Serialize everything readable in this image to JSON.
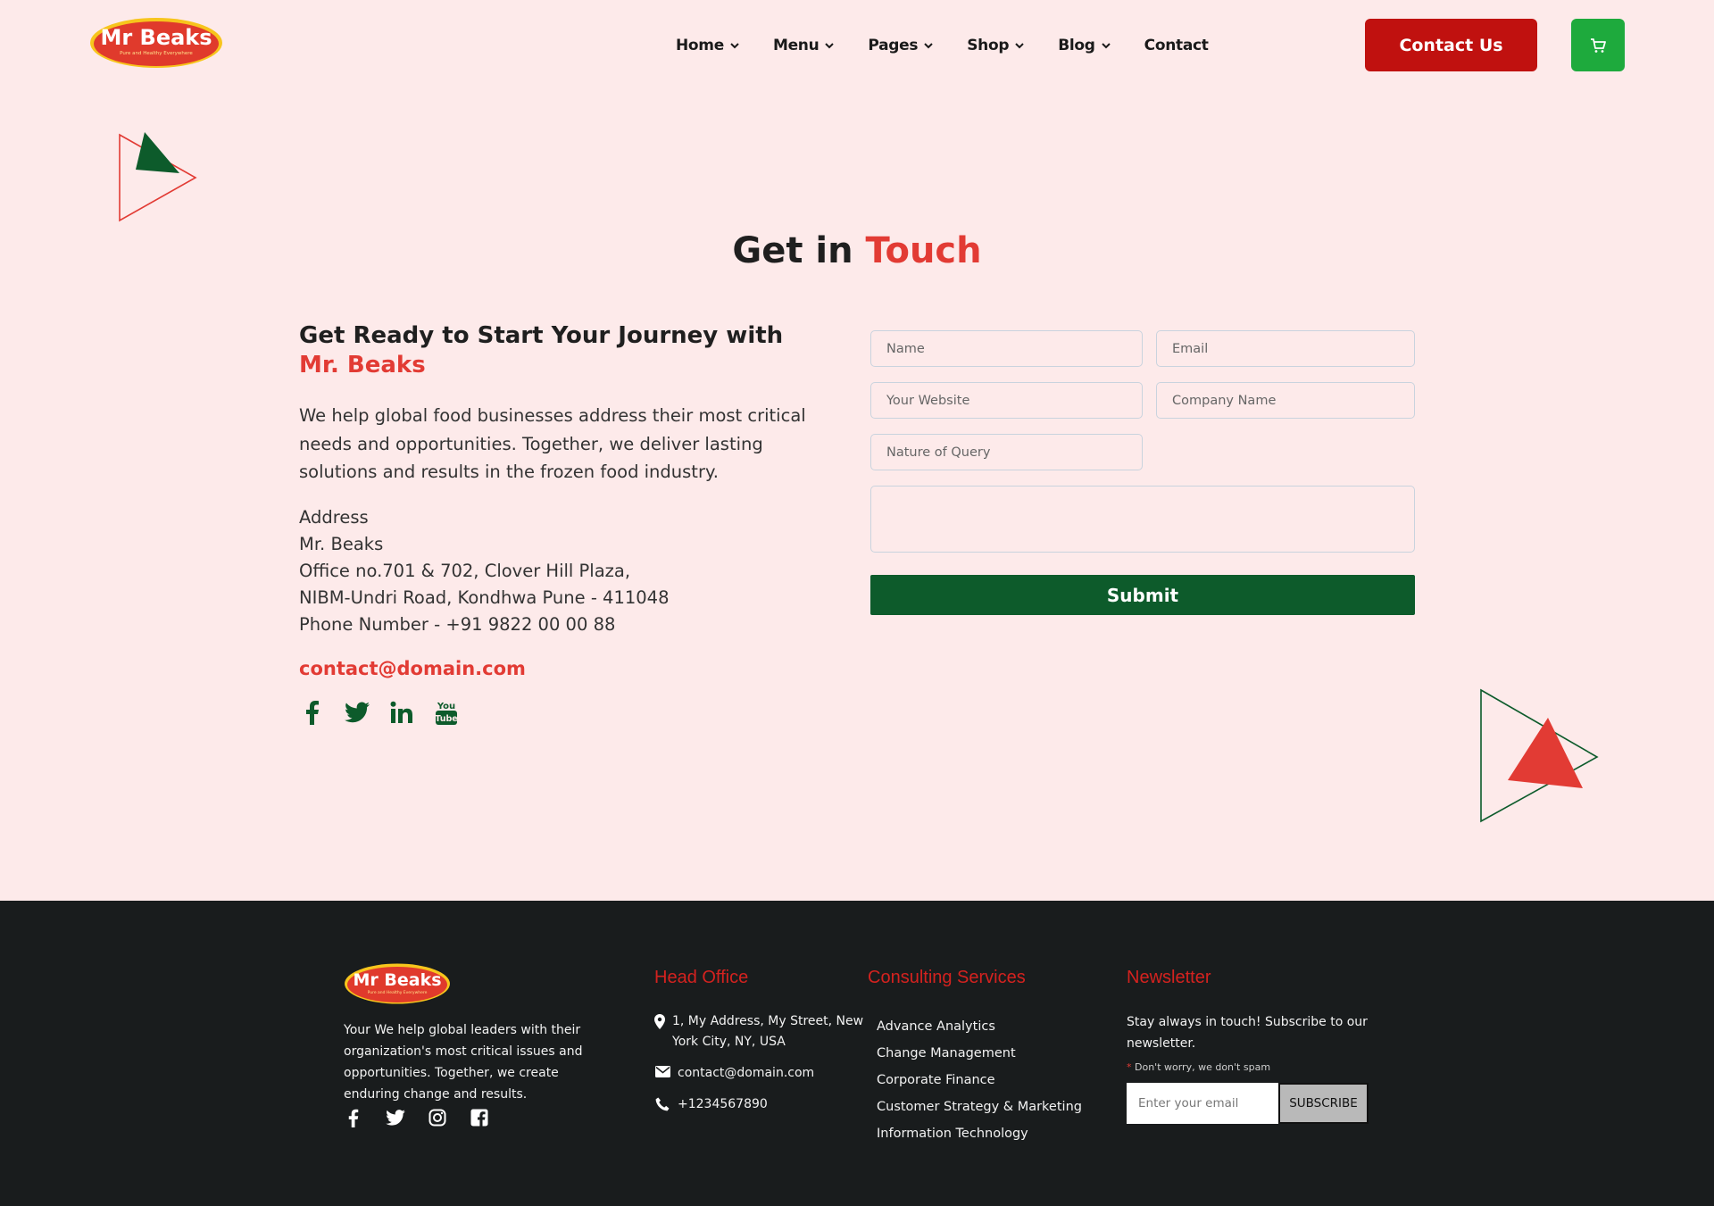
{
  "brand": {
    "logo_text": "Mr Beaks",
    "logo_tagline": "Pure and Healthy Everywhere"
  },
  "nav": {
    "items": [
      {
        "label": "Home",
        "has_dropdown": true
      },
      {
        "label": "Menu",
        "has_dropdown": true
      },
      {
        "label": "Pages",
        "has_dropdown": true
      },
      {
        "label": "Shop",
        "has_dropdown": true
      },
      {
        "label": "Blog",
        "has_dropdown": true
      },
      {
        "label": "Contact",
        "has_dropdown": false
      }
    ],
    "contact_button": "Contact Us",
    "cart_icon": "cart-icon"
  },
  "contact_section": {
    "title_main": "Get in",
    "title_accent": "Touch",
    "heading_main": "Get Ready to Start Your Journey with",
    "heading_accent": "Mr. Beaks",
    "intro": "We help global food businesses address their most critical needs and opportunities. Together, we deliver lasting solutions and results in the frozen food industry.",
    "address_label": "Address",
    "address_company": "Mr. Beaks",
    "address_line1": "Office no.701 & 702, Clover Hill Plaza,",
    "address_line2": "NIBM-Undri Road, Kondhwa Pune - 411048",
    "phone": "Phone Number - +91 9822 00 00 88",
    "email": "contact@domain.com",
    "socials": [
      "facebook-icon",
      "twitter-icon",
      "linkedin-icon",
      "youtube-icon"
    ]
  },
  "form": {
    "name_placeholder": "Name",
    "email_placeholder": "Email",
    "website_placeholder": "Your Website",
    "company_placeholder": "Company Name",
    "query_placeholder": "Nature of Query",
    "message_placeholder": "",
    "submit_label": "Submit"
  },
  "footer": {
    "about": "Your We help global leaders with their organization's most critical issues and opportunities. Together, we create enduring change and results.",
    "socials": [
      "facebook-icon",
      "twitter-icon",
      "instagram-icon",
      "facebook-square-icon"
    ],
    "head_office_title": "Head Office",
    "address": "1, My Address, My Street, New York City, NY, USA",
    "email": "contact@domain.com",
    "phone": "+1234567890",
    "services_title": "Consulting Services",
    "services": [
      "Advance Analytics",
      "Change Management",
      "Corporate Finance",
      "Customer Strategy & Marketing",
      "Information Technology"
    ],
    "newsletter_title": "Newsletter",
    "newsletter_text": "Stay always in touch! Subscribe to our newsletter.",
    "spam_star": "*",
    "spam_note": "Don't worry, we don't spam",
    "email_placeholder": "Enter your email",
    "subscribe_label": "SUBSCRIBE"
  },
  "colors": {
    "accent_red": "#e23b34",
    "button_red": "#c0110f",
    "cart_green": "#1eaa3d",
    "submit_green": "#0d5b2b",
    "page_bg": "#fdeaea",
    "footer_bg": "#191c1d"
  }
}
